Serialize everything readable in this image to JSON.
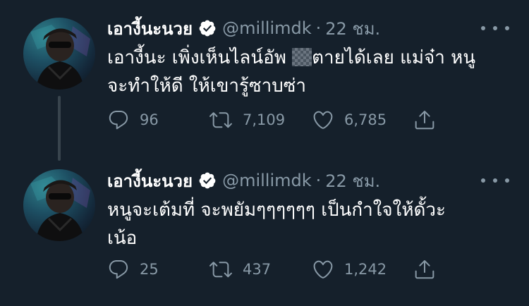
{
  "tweets": [
    {
      "display_name": "เอางี้นะนวย",
      "handle": "@millimdk",
      "separator": "·",
      "time": "22 ชม.",
      "text_line1_before": "เอางี้นะ เพิ่งเห็นไลน์อัพ ",
      "text_line1_after": "ตายได้เลย แม่จ๋า หนู",
      "text_line2": "จะทำให้ดี ให้เขารู้ซาบซ่า",
      "replies": "96",
      "retweets": "7,109",
      "likes": "6,785"
    },
    {
      "display_name": "เอางี้นะนวย",
      "handle": "@millimdk",
      "separator": "·",
      "time": "22 ชม.",
      "text_line1": "หนูจะเต้มที่ จะพยัมๆๆๆๆๆๆ เป็นกำใจให้ดั้วะ",
      "text_line2": "เน้อ",
      "replies": "25",
      "retweets": "437",
      "likes": "1,242"
    }
  ],
  "icons": {
    "verified": "verified-badge-icon",
    "more": "more-options-icon",
    "reply": "reply-icon",
    "retweet": "retweet-icon",
    "like": "like-heart-icon",
    "share": "share-icon"
  },
  "colors": {
    "background": "#15202b",
    "secondary_text": "#8899a6",
    "thread_line": "#38444d",
    "verified_badge": "#ffffff"
  }
}
